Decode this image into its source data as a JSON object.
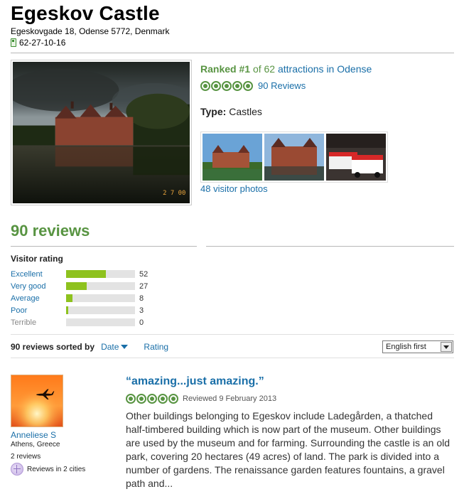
{
  "header": {
    "title": "Egeskov Castle",
    "address": "Egeskovgade 18, Odense 5772, Denmark",
    "phone": "62-27-10-16"
  },
  "summary": {
    "ranked_prefix": "Ranked #1",
    "ranked_of": "of 62",
    "ranked_link": "attractions in Odense",
    "reviews_link": "90 Reviews",
    "type_label": "Type:",
    "type_value": "Castles",
    "visitor_photos_link": "48 visitor photos",
    "bubble_rating": 5
  },
  "reviews_section": {
    "heading": "90 reviews",
    "visitor_rating_label": "Visitor rating",
    "rating_breakdown": [
      {
        "label": "Excellent",
        "count": "52",
        "fraction": 0.58
      },
      {
        "label": "Very good",
        "count": "27",
        "fraction": 0.3
      },
      {
        "label": "Average",
        "count": "8",
        "fraction": 0.09
      },
      {
        "label": "Poor",
        "count": "3",
        "fraction": 0.03
      },
      {
        "label": "Terrible",
        "count": "0",
        "fraction": 0
      }
    ],
    "sorted_by_label": "90 reviews sorted by",
    "sort_date": "Date",
    "sort_rating": "Rating",
    "language_select": "English first"
  },
  "review": {
    "user_name": "Anneliese S",
    "user_location": "Athens, Greece",
    "user_review_count": "2 reviews",
    "user_cities": "Reviews in 2 cities",
    "title": "“amazing...just amazing.”",
    "reviewed_date": "Reviewed 9 February 2013",
    "body": "Other buildings belonging to Egeskov include Ladegården, a thatched half-timbered building which is now part of the museum. Other buildings are used by the museum and for farming. Surrounding the castle is an old park, covering 20 hectares (49 acres) of land. The park is divided into a number of gardens. The renaissance garden features fountains, a gravel path and...",
    "bubble_rating": 5
  },
  "colors": {
    "brand_green": "#589442",
    "link_blue": "#1a6fa8",
    "bar_green": "#8ec21e"
  }
}
